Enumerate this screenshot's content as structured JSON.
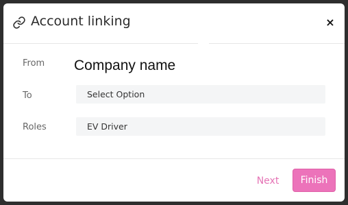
{
  "modal": {
    "title": "Account linking",
    "close_label": "×",
    "link_icon": "link-icon"
  },
  "form": {
    "from_label": "From",
    "from_value": "Company name",
    "to_label": "To",
    "to_value": "Select Option",
    "roles_label": "Roles",
    "roles_value": "EV Driver"
  },
  "footer": {
    "next_label": "Next",
    "finish_label": "Finish"
  },
  "colors": {
    "accent": "#ec73ba",
    "next_text": "#e573b5",
    "field_bg": "#f4f5f6",
    "backdrop": "#2e2e2e"
  }
}
